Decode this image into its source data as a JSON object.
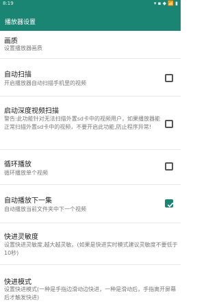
{
  "status_bar": {
    "time": "8:19",
    "indicators": "▾ ▪ ◆ 📶 ▮"
  },
  "header": {
    "title": "播放器设置"
  },
  "items": [
    {
      "title": "画质",
      "subtitle": "设置播放器画质",
      "checkbox": null
    },
    {
      "title": "自动扫描",
      "subtitle": "开启播放器自动扫描手机里的视频",
      "checkbox": false
    },
    {
      "title": "启动深度视频扫描",
      "subtitle": "警告:此功能针对无法扫描外置sd卡中的视频用户，如果播放器能正常扫描外置sd卡中的视频，不要开启此功能,防止程序异常!",
      "checkbox": false
    },
    {
      "title": "循环播放",
      "subtitle": "循环播放单个视频",
      "checkbox": false
    },
    {
      "title": "自动播放下一集",
      "subtitle": "自动播放当前文件夹中下一个视频",
      "checkbox": true
    },
    {
      "title": "快进灵敏度",
      "subtitle": "设置快进灵敏度,越大越灵敏。(如果是快进实时模式建议灵敏度不要低于10秒)",
      "checkbox": null
    },
    {
      "title": "快进模式",
      "subtitle": "设置快进模式(一种是手指边滑动边快进，一种是滑动后，手指离开屏幕后才触发快进)",
      "checkbox": null
    }
  ],
  "colors": {
    "accent": "#1a8573",
    "background": "#ffffff"
  }
}
